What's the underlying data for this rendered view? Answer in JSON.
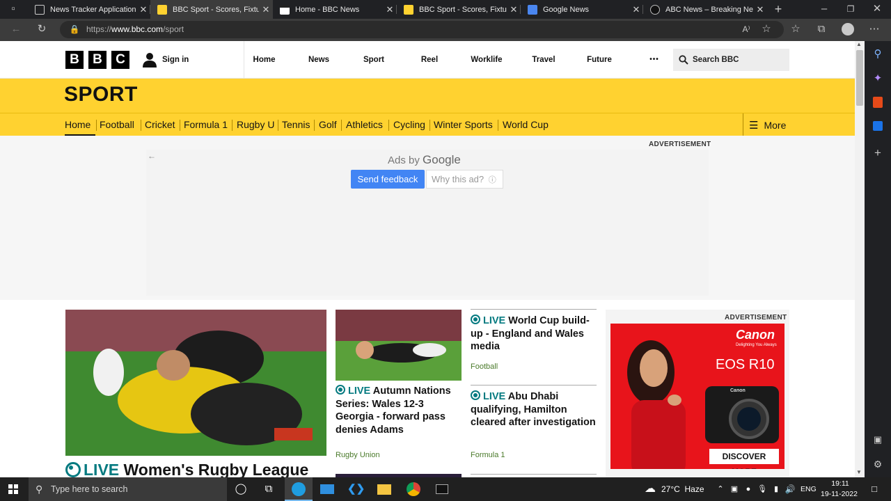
{
  "browser": {
    "tabs": [
      {
        "title": "News Tracker Application",
        "color": "#e0e0e0"
      },
      {
        "title": "BBC Sport - Scores, Fixtures",
        "color": "#ffd230"
      },
      {
        "title": "Home - BBC News",
        "color": "#ffffff"
      },
      {
        "title": "BBC Sport - Scores, Fixtures",
        "color": "#ffd230"
      },
      {
        "title": "Google News",
        "color": "#4a86f0"
      },
      {
        "title": "ABC News – Breaking News",
        "color": "#ffffff"
      }
    ],
    "url_prefix": "https://",
    "url_domain": "www.bbc.com",
    "url_path": "/sport",
    "new_tab": "+"
  },
  "bbc": {
    "logo": [
      "B",
      "B",
      "C"
    ],
    "signin": "Sign in",
    "nav": [
      "Home",
      "News",
      "Sport",
      "Reel",
      "Worklife",
      "Travel",
      "Future"
    ],
    "more_dots": "•••",
    "search_label": "Search BBC"
  },
  "sport": {
    "title": "SPORT",
    "subnav": [
      "Home",
      "Football",
      "Cricket",
      "Formula 1",
      "Rugby U",
      "Tennis",
      "Golf",
      "Athletics",
      "Cycling",
      "Winter Sports",
      "World Cup"
    ],
    "more": "More"
  },
  "ad": {
    "label": "ADVERTISEMENT",
    "ads_by": "Ads by",
    "google": "Google",
    "send_feedback": "Send feedback",
    "why_ad": "Why this ad?"
  },
  "stories": {
    "main": {
      "live": "LIVE",
      "headline": "Women's Rugby League"
    },
    "second": {
      "live": "LIVE",
      "headline": "Autumn Nations Series: Wales 12-3 Georgia - forward pass denies Adams",
      "tag": "Rugby Union"
    },
    "third": {
      "live": "LIVE",
      "headline": "World Cup build-up - England and Wales media",
      "tag": "Football"
    },
    "fourth": {
      "live": "LIVE",
      "headline": "Abu Dhabi qualifying, Hamilton cleared after investigation",
      "tag": "Formula 1"
    }
  },
  "side_ad": {
    "label": "ADVERTISEMENT",
    "brand": "Canon",
    "brand_tagline": "Delighting You Always",
    "product": "EOS R10",
    "camera_mark": "Canon",
    "cta": "DISCOVER MORE"
  },
  "taskbar": {
    "search_placeholder": "Type here to search",
    "weather": "27°C  Haze",
    "lang": "ENG",
    "time": "19:11",
    "date": "19-11-2022"
  }
}
